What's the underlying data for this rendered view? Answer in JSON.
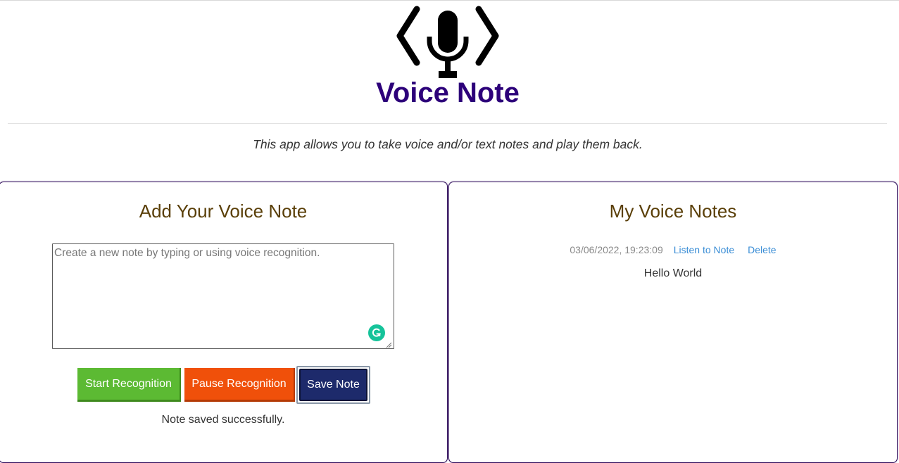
{
  "app": {
    "title": "Voice Note",
    "intro": "This app allows you to take voice and/or text notes and play them back."
  },
  "add_panel": {
    "title": "Add Your Voice Note",
    "textarea_value": "",
    "textarea_placeholder": "Create a new note by typing or using voice recognition.",
    "start_label": "Start Recognition",
    "pause_label": "Pause Recognition",
    "save_label": "Save Note",
    "status": "Note saved successfully."
  },
  "notes_panel": {
    "title": "My Voice Notes",
    "notes": [
      {
        "date": "03/06/2022, 19:23:09",
        "listen_label": "Listen to Note",
        "delete_label": "Delete",
        "text": "Hello World"
      }
    ]
  },
  "colors": {
    "title": "#2d007a",
    "panel_title": "#5a3f08",
    "start_button": "#5cba33",
    "pause_button": "#f0500a",
    "save_button": "#1d2a6b",
    "link": "#3b8ed6"
  },
  "icons": [
    "microphone-code-logo-icon",
    "grammarly-icon"
  ]
}
